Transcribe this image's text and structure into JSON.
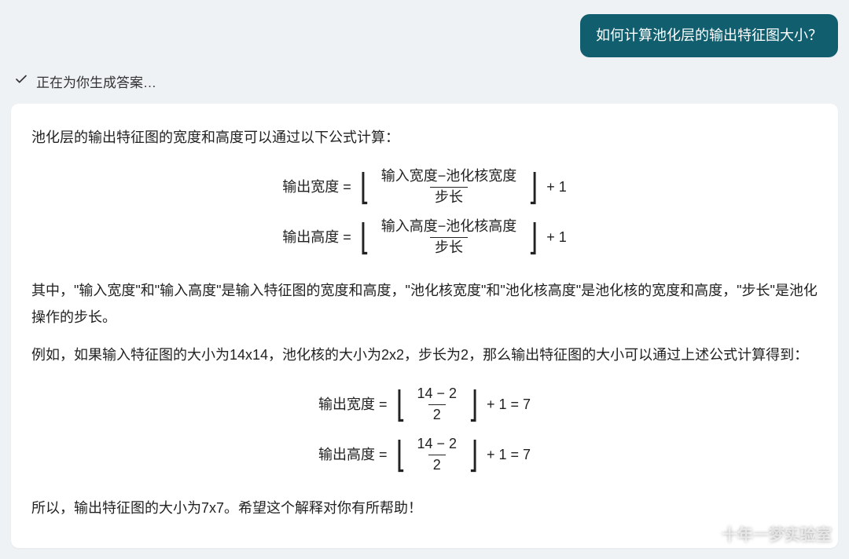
{
  "colors": {
    "user_bubble_bg": "#115e6e",
    "user_bubble_text": "#ffffff",
    "page_bg": "#eef2f5",
    "card_bg": "#ffffff"
  },
  "user_message": "如何计算池化层的输出特征图大小？",
  "status": {
    "icon": "check-icon",
    "text": "正在为你生成答案…"
  },
  "answer": {
    "p1": "池化层的输出特征图的宽度和高度可以通过以下公式计算：",
    "formula1": {
      "lhs": "输出宽度 =",
      "num": "输入宽度−池化核宽度",
      "den": "步长",
      "tail": "+ 1"
    },
    "formula2": {
      "lhs": "输出高度 =",
      "num": "输入高度−池化核高度",
      "den": "步长",
      "tail": "+ 1"
    },
    "p2": "其中，\"输入宽度\"和\"输入高度\"是输入特征图的宽度和高度，\"池化核宽度\"和\"池化核高度\"是池化核的宽度和高度，\"步长\"是池化操作的步长。",
    "p3": "例如，如果输入特征图的大小为14x14，池化核的大小为2x2，步长为2，那么输出特征图的大小可以通过上述公式计算得到：",
    "formula3": {
      "lhs": "输出宽度 =",
      "num": "14 − 2",
      "den": "2",
      "tail": "+ 1 = 7"
    },
    "formula4": {
      "lhs": "输出高度 =",
      "num": "14 − 2",
      "den": "2",
      "tail": "+ 1 = 7"
    },
    "p4": "所以，输出特征图的大小为7x7。希望这个解释对你有所帮助！"
  },
  "watermark": {
    "icon": "wechat-icon",
    "text": "十年一梦实验室"
  }
}
